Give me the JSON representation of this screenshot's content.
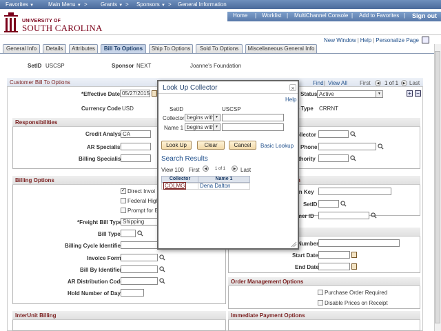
{
  "menubar": {
    "favorites": "Favorites",
    "main_menu": "Main Menu",
    "grants": "Grants",
    "sponsors": "Sponsors",
    "general_info": "General Information"
  },
  "header": {
    "logo_line1": "UNIVERSITY OF",
    "logo_line2": "SOUTH CAROLINA",
    "home": "Home",
    "worklist": "Worklist",
    "multichannel": "MultiChannel Console",
    "add_favorites": "Add to Favorites",
    "sign_out": "Sign out"
  },
  "util": {
    "new_window": "New Window",
    "help": "Help",
    "personalize": "Personalize Page"
  },
  "tabs": [
    {
      "label": "General Info"
    },
    {
      "label": "Details"
    },
    {
      "label": "Attributes"
    },
    {
      "label": "Bill To Options",
      "active": true
    },
    {
      "label": "Ship To Options"
    },
    {
      "label": "Sold To Options"
    },
    {
      "label": "Miscellaneous General Info"
    }
  ],
  "key": {
    "setid_label": "SetID",
    "setid_value": "USCSP",
    "sponsor_label": "Sponsor",
    "sponsor_value": "NEXT",
    "sponsor_name": "Joanne's Foundation"
  },
  "cbt": {
    "title": "Customer Bill To Options",
    "find": "Find",
    "view_all": "View All",
    "first": "First",
    "range": "1 of 1",
    "last": "Last",
    "effective_date_label": "*Effective Date",
    "effective_date_value": "05/27/2015",
    "status_label": "Status",
    "status_value": "Active",
    "currency_label": "Currency Code",
    "currency_value": "USD",
    "rate_type_label": "e Type",
    "rate_type_value": "CRRNT"
  },
  "responsibilities": {
    "title": "Responsibilities",
    "credit_analyst_label": "Credit Analyst",
    "credit_analyst_value": "CA",
    "ar_specialist_label": "AR Specialist",
    "billing_specialist_label": "Billing Specialist",
    "collector_label": "ollector",
    "phone_label": "Phone",
    "authority_label": "uthority"
  },
  "billing": {
    "title": "Billing Options",
    "direct_invoicing": "Direct Invoi",
    "federal_high": "Federal High",
    "prompt_for": "Prompt for B",
    "freight_label": "*Freight Bill Type",
    "freight_value": "Shipping",
    "bill_type_label": "Bill Type",
    "cycle_label": "Billing Cycle Identifier",
    "invoice_form_label": "Invoice Form",
    "bill_by_label": "Bill By Identifier",
    "ar_dist_label": "AR Distribution Code",
    "hold_days_label": "Hold Number of Days"
  },
  "right": {
    "sect_title": "n",
    "sect2_title": "",
    "on_key_label": "tion Key",
    "setid_label": "SetID",
    "customer_id_label": "omer ID",
    "number_label": "Number",
    "start_date_label": "Start Date",
    "end_date_label": "End Date"
  },
  "order_mgmt": {
    "title": "Order Management Options",
    "po_required": "Purchase Order Required",
    "disable_prices": "Disable Prices on Receipt"
  },
  "interunit": {
    "title": "InterUnit Billing"
  },
  "immediate": {
    "title": "Immediate Payment Options"
  },
  "modal": {
    "title": "Look Up Collector",
    "close": "×",
    "help": "Help",
    "setid_label": "SetID",
    "setid_value": "USCSP",
    "collector_label": "Collector",
    "collector_op": "begins with",
    "name1_label": "Name 1",
    "name1_op": "begins with",
    "look_up": "Look Up",
    "clear": "Clear",
    "cancel": "Cancel",
    "basic_lookup": "Basic Lookup",
    "results_title": "Search Results",
    "view100": "View 100",
    "first": "First",
    "range": "1 of 1",
    "last": "Last",
    "columns": [
      "Collector",
      "Name 1"
    ],
    "rows": [
      {
        "collector": "COLMG",
        "name": "Dena Dalton"
      }
    ]
  }
}
